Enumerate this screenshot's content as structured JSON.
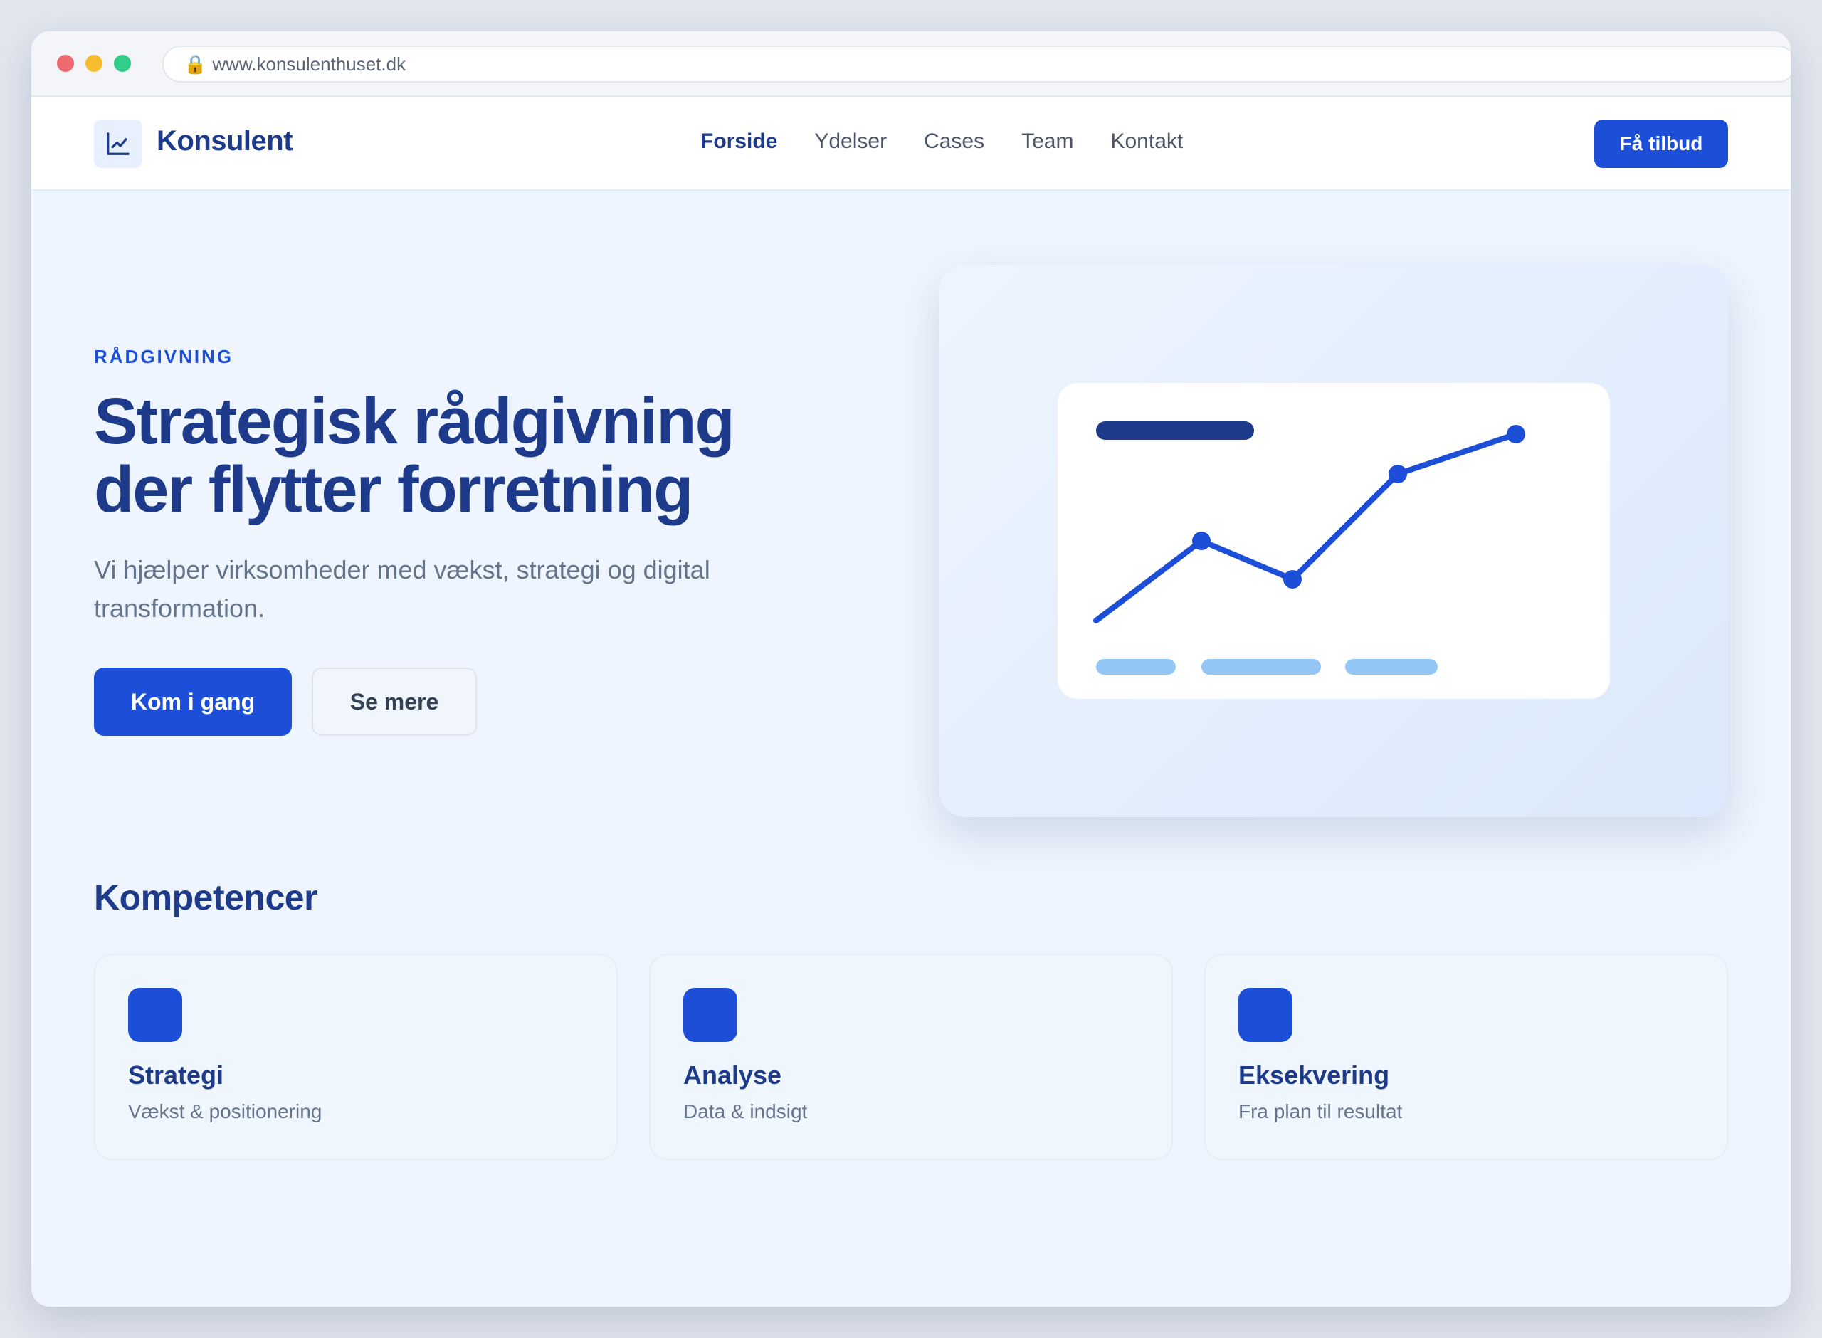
{
  "browser": {
    "url": "www.konsulenthuset.dk"
  },
  "nav": {
    "brand": "Konsulent",
    "links": [
      "Forside",
      "Ydelser",
      "Cases",
      "Team",
      "Kontakt"
    ],
    "active_link": "Forside",
    "cta_label": "Få tilbud"
  },
  "hero": {
    "eyebrow": "RÅDGIVNING",
    "headline_line1": "Strategisk rådgivning",
    "headline_line2": "der flytter forretning",
    "subtitle": "Vi hjælper virksomheder med vækst, strategi og digital transformation.",
    "primary_button": "Kom i gang",
    "secondary_button": "Se mere"
  },
  "section": {
    "title": "Kompetencer",
    "cards": [
      {
        "title": "Strategi",
        "desc": "Vækst & positionering"
      },
      {
        "title": "Analyse",
        "desc": "Data & indsigt"
      },
      {
        "title": "Eksekvering",
        "desc": "Fra plan til resultat"
      }
    ]
  },
  "colors": {
    "brand": "#1e3a8a",
    "accent": "#1d4ed8",
    "page_bg": "#eef5fe",
    "muted_text": "#64748b",
    "placeholder_bar": "#93c5f5"
  },
  "icons": {
    "lock": "lock-icon",
    "logo": "line-chart-icon"
  }
}
